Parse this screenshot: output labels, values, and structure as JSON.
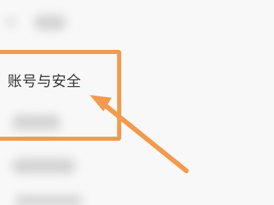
{
  "menu_item": {
    "label": "账号与安全"
  },
  "annotation": {
    "highlight_color": "#f39a4c",
    "arrow_color": "#f39a4c"
  }
}
